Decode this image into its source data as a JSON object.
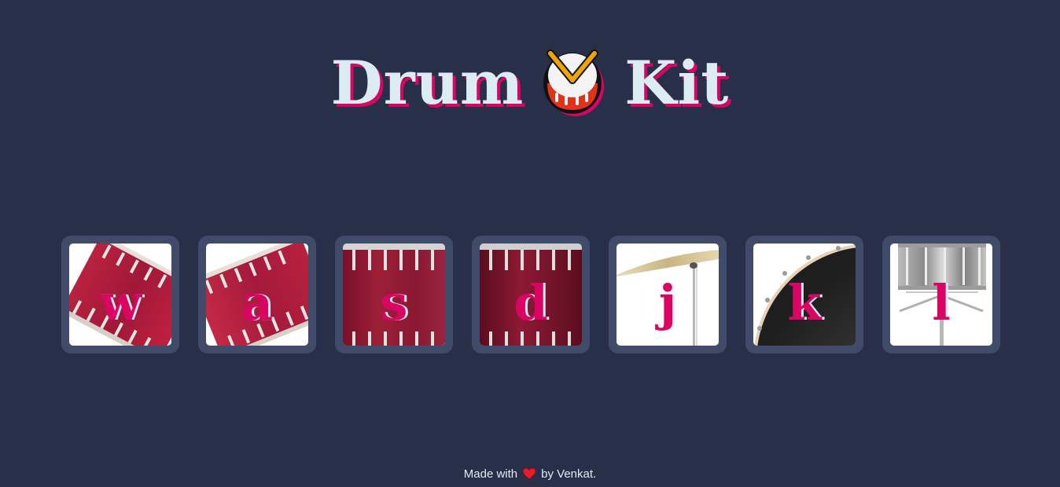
{
  "header": {
    "title_left": "Drum",
    "title_right": "Kit",
    "title_icon": "drum-emoji-icon"
  },
  "colors": {
    "background": "#283049",
    "tile": "#404b69",
    "accent": "#da0463",
    "text": "#dbedf3"
  },
  "drums": [
    {
      "key": "w",
      "image": "tom-drum-tilted"
    },
    {
      "key": "a",
      "image": "tom-drum-tilted"
    },
    {
      "key": "s",
      "image": "floor-tom-drum"
    },
    {
      "key": "d",
      "image": "floor-tom-drum"
    },
    {
      "key": "j",
      "image": "crash-cymbal"
    },
    {
      "key": "k",
      "image": "kick-drum"
    },
    {
      "key": "l",
      "image": "snare-drum"
    }
  ],
  "footer": {
    "prefix": "Made with",
    "icon": "heart-icon",
    "suffix": "by Venkat."
  }
}
